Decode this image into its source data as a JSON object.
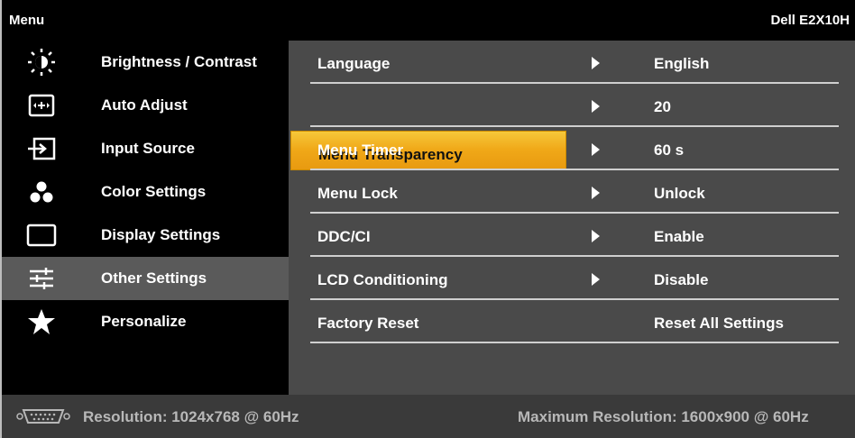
{
  "header": {
    "title": "Menu",
    "model": "Dell E2X10H"
  },
  "sidebar": {
    "items": [
      {
        "label": "Brightness / Contrast",
        "icon": "brightness-icon"
      },
      {
        "label": "Auto Adjust",
        "icon": "auto-adjust-icon"
      },
      {
        "label": "Input Source",
        "icon": "input-source-icon"
      },
      {
        "label": "Color Settings",
        "icon": "color-settings-icon"
      },
      {
        "label": "Display Settings",
        "icon": "display-settings-icon"
      },
      {
        "label": "Other Settings",
        "icon": "sliders-icon",
        "active": true
      },
      {
        "label": "Personalize",
        "icon": "star-icon"
      }
    ]
  },
  "content": {
    "rows": [
      {
        "name": "Language",
        "value": "English"
      },
      {
        "name": "Menu Transparency",
        "value": "20",
        "selected": true
      },
      {
        "name": "Menu Timer",
        "value": "60 s"
      },
      {
        "name": "Menu Lock",
        "value": "Unlock"
      },
      {
        "name": "DDC/CI",
        "value": "Enable"
      },
      {
        "name": "LCD Conditioning",
        "value": "Disable"
      },
      {
        "name": "Factory Reset",
        "value": "Reset All Settings"
      }
    ]
  },
  "footer": {
    "resolution": "Resolution: 1024x768 @ 60Hz",
    "max_resolution": "Maximum Resolution: 1600x900 @ 60Hz"
  },
  "colors": {
    "highlight": "#f0a818",
    "content_bg": "#4a4a4a",
    "active_sidebar_bg": "#5a5a5a",
    "footer_bg": "#3a3a3a"
  }
}
